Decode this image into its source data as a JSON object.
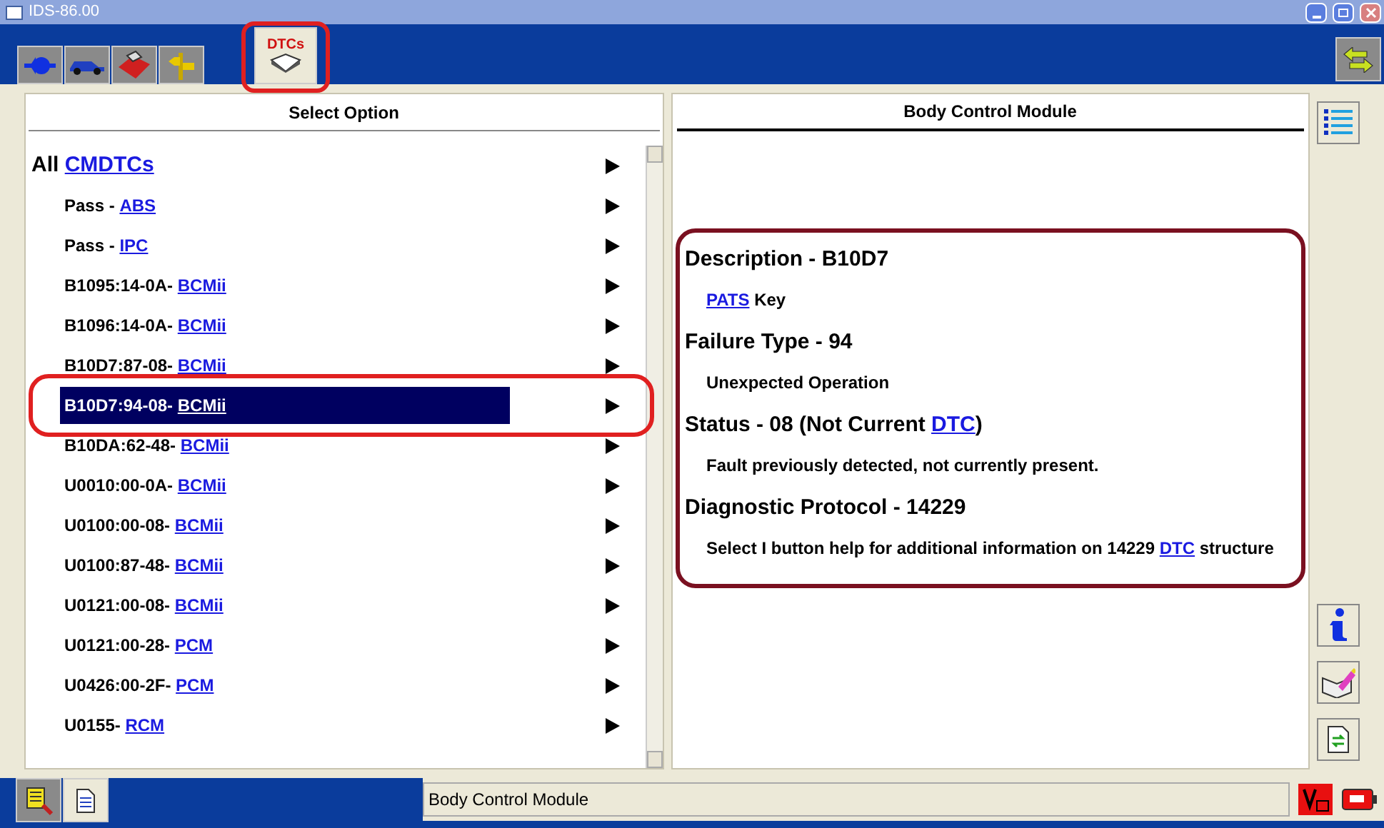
{
  "window": {
    "title": "IDS-86.00"
  },
  "tabs": [
    {
      "kind": "connector",
      "selected": false
    },
    {
      "kind": "vehicle",
      "selected": false
    },
    {
      "kind": "toolbox",
      "selected": false
    },
    {
      "kind": "signpost",
      "selected": false
    },
    {
      "kind": "dtc",
      "label": "DTCs",
      "selected": true,
      "circled": true
    }
  ],
  "left_panel": {
    "title": "Select Option",
    "header": {
      "text": "All",
      "link": "CMDTCs"
    },
    "items": [
      {
        "text": "Pass -",
        "link": "ABS",
        "selected": false,
        "circled": false
      },
      {
        "text": "Pass -",
        "link": "IPC",
        "selected": false,
        "circled": false
      },
      {
        "text": "B1095:14-0A-",
        "link": "BCMii",
        "selected": false,
        "circled": false
      },
      {
        "text": "B1096:14-0A-",
        "link": "BCMii",
        "selected": false,
        "circled": false
      },
      {
        "text": "B10D7:87-08-",
        "link": "BCMii",
        "selected": false,
        "circled": false
      },
      {
        "text": "B10D7:94-08-",
        "link": "BCMii",
        "selected": true,
        "circled": true
      },
      {
        "text": "B10DA:62-48-",
        "link": "BCMii",
        "selected": false,
        "circled": false
      },
      {
        "text": "U0010:00-0A-",
        "link": "BCMii",
        "selected": false,
        "circled": false
      },
      {
        "text": "U0100:00-08-",
        "link": "BCMii",
        "selected": false,
        "circled": false
      },
      {
        "text": "U0100:87-48-",
        "link": "BCMii",
        "selected": false,
        "circled": false
      },
      {
        "text": "U0121:00-08-",
        "link": "BCMii",
        "selected": false,
        "circled": false
      },
      {
        "text": "U0121:00-28-",
        "link": "PCM",
        "selected": false,
        "circled": false
      },
      {
        "text": "U0426:00-2F-",
        "link": "PCM",
        "selected": false,
        "circled": false
      },
      {
        "text": "U0155-",
        "link": "RCM",
        "selected": false,
        "circled": false
      }
    ]
  },
  "right_panel": {
    "title": "Body Control Module",
    "framed": true,
    "sections": [
      {
        "heading": [
          {
            "text": "Description - B10D7"
          }
        ],
        "body": [
          {
            "text": "PATS",
            "link": true
          },
          {
            "text": " Key"
          }
        ]
      },
      {
        "heading": [
          {
            "text": "Failure Type - 94"
          }
        ],
        "body": [
          {
            "text": "Unexpected Operation"
          }
        ]
      },
      {
        "heading": [
          {
            "text": "Status - 08 (Not Current "
          },
          {
            "text": "DTC",
            "link": true
          },
          {
            "text": ")"
          }
        ],
        "body": [
          {
            "text": "Fault previously detected, not currently present."
          }
        ]
      },
      {
        "heading": [
          {
            "text": "Diagnostic Protocol - 14229"
          }
        ],
        "body": [
          {
            "text": "Select I button help for additional information on 14229 "
          },
          {
            "text": "DTC",
            "link": true
          },
          {
            "text": " structure"
          }
        ]
      }
    ]
  },
  "status_bar": {
    "text": "Body Control Module"
  }
}
